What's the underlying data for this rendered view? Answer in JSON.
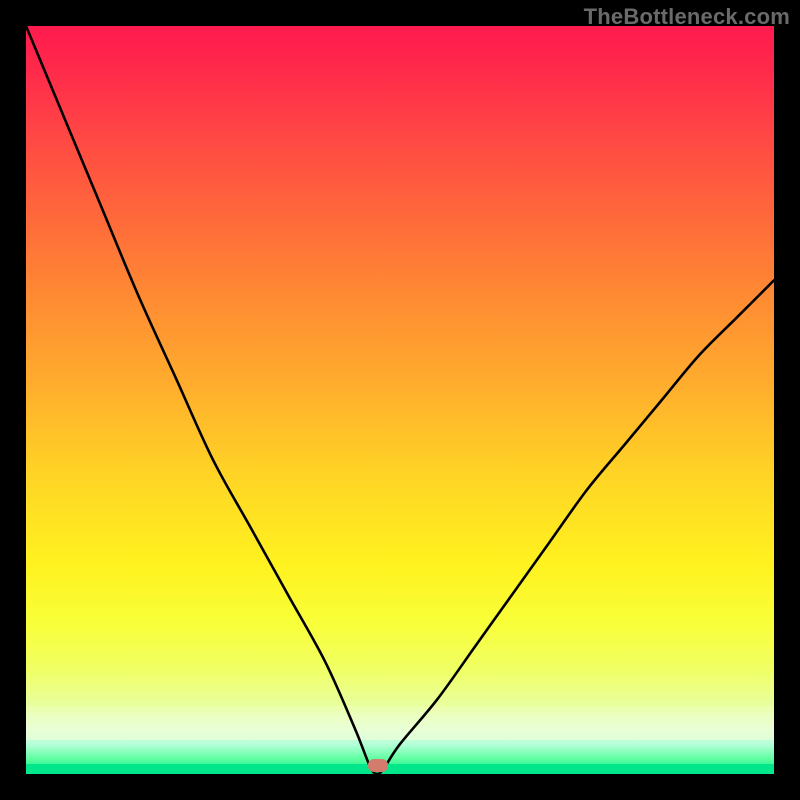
{
  "watermark": "TheBottleneck.com",
  "chart_data": {
    "type": "line",
    "title": "",
    "xlabel": "",
    "ylabel": "",
    "xlim": [
      0,
      100
    ],
    "ylim": [
      0,
      100
    ],
    "grid": false,
    "annotations": {
      "marker": {
        "x": 47,
        "y": 0,
        "shape": "rounded-rect",
        "color": "#d37b6d"
      }
    },
    "series": [
      {
        "name": "bottleneck-curve",
        "x": [
          0,
          5,
          10,
          15,
          20,
          25,
          30,
          35,
          40,
          44,
          46,
          47,
          48,
          50,
          55,
          60,
          65,
          70,
          75,
          80,
          85,
          90,
          95,
          100
        ],
        "values": [
          100,
          88,
          76,
          64,
          53,
          42,
          33,
          24,
          15,
          6,
          1,
          0,
          1,
          4,
          10,
          17,
          24,
          31,
          38,
          44,
          50,
          56,
          61,
          66
        ]
      }
    ],
    "background_gradient": {
      "direction": "top-to-bottom",
      "stops": [
        {
          "pos": 0.0,
          "color": "#ff1a4f"
        },
        {
          "pos": 0.25,
          "color": "#ff7a36"
        },
        {
          "pos": 0.55,
          "color": "#ffd026"
        },
        {
          "pos": 0.8,
          "color": "#f6ff40"
        },
        {
          "pos": 0.95,
          "color": "#ccffd2"
        },
        {
          "pos": 1.0,
          "color": "#00e88c"
        }
      ]
    }
  }
}
